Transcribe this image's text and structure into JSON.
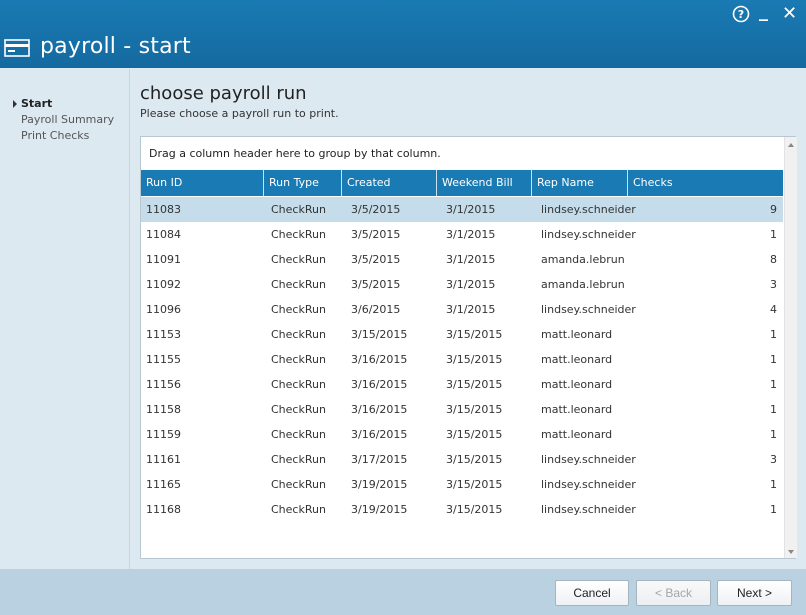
{
  "window": {
    "title": "payroll - start",
    "help_icon": "help-circle-icon",
    "minimize_glyph": "_",
    "close_glyph": "✕",
    "accent_color": "#1a7ab3"
  },
  "sidebar": {
    "items": [
      {
        "label": "Start",
        "active": true
      },
      {
        "label": "Payroll Summary",
        "active": false
      },
      {
        "label": "Print Checks",
        "active": false
      }
    ]
  },
  "main": {
    "heading": "choose payroll run",
    "subheading": "Please choose a payroll run to print.",
    "group_hint": "Drag a column header here to group by that column."
  },
  "grid": {
    "columns": [
      "Run ID",
      "Run Type",
      "Created",
      "Weekend Bill",
      "Rep Name",
      "Checks"
    ],
    "rows": [
      [
        "11083",
        "CheckRun",
        "3/5/2015",
        "3/1/2015",
        "lindsey.schneider",
        "9"
      ],
      [
        "11084",
        "CheckRun",
        "3/5/2015",
        "3/1/2015",
        "lindsey.schneider",
        "1"
      ],
      [
        "11091",
        "CheckRun",
        "3/5/2015",
        "3/1/2015",
        "amanda.lebrun",
        "8"
      ],
      [
        "11092",
        "CheckRun",
        "3/5/2015",
        "3/1/2015",
        "amanda.lebrun",
        "3"
      ],
      [
        "11096",
        "CheckRun",
        "3/6/2015",
        "3/1/2015",
        "lindsey.schneider",
        "4"
      ],
      [
        "11153",
        "CheckRun",
        "3/15/2015",
        "3/15/2015",
        "matt.leonard",
        "1"
      ],
      [
        "11155",
        "CheckRun",
        "3/16/2015",
        "3/15/2015",
        "matt.leonard",
        "1"
      ],
      [
        "11156",
        "CheckRun",
        "3/16/2015",
        "3/15/2015",
        "matt.leonard",
        "1"
      ],
      [
        "11158",
        "CheckRun",
        "3/16/2015",
        "3/15/2015",
        "matt.leonard",
        "1"
      ],
      [
        "11159",
        "CheckRun",
        "3/16/2015",
        "3/15/2015",
        "matt.leonard",
        "1"
      ],
      [
        "11161",
        "CheckRun",
        "3/17/2015",
        "3/15/2015",
        "lindsey.schneider",
        "3"
      ],
      [
        "11165",
        "CheckRun",
        "3/19/2015",
        "3/15/2015",
        "lindsey.schneider",
        "1"
      ],
      [
        "11168",
        "CheckRun",
        "3/19/2015",
        "3/15/2015",
        "lindsey.schneider",
        "1"
      ]
    ],
    "selected_row": 0
  },
  "footer": {
    "cancel_label": "Cancel",
    "back_label": "< Back",
    "next_label": "Next >"
  }
}
